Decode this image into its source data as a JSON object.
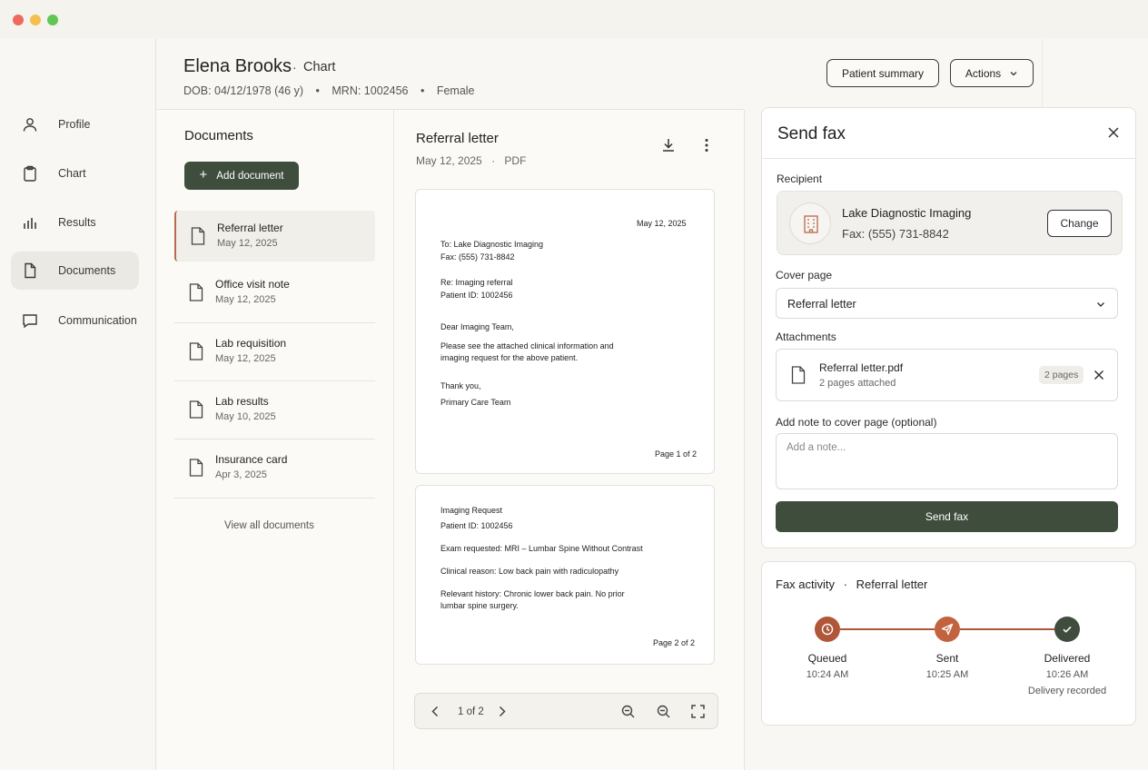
{
  "patient": {
    "name": "Elena Brooks",
    "sep": "·",
    "section": "Chart",
    "dob": "DOB: 04/12/1978 (46 y)",
    "dot": "•",
    "mrn": "MRN: 1002456",
    "sex": "Female"
  },
  "header_actions": {
    "summary_label": "Patient summary",
    "actions_label": "Actions"
  },
  "sidebar": {
    "items": [
      {
        "label": "Profile",
        "icon": "person-icon"
      },
      {
        "label": "Chart",
        "icon": "clipboard-icon"
      },
      {
        "label": "Results",
        "icon": "bar-chart-icon"
      },
      {
        "label": "Documents",
        "icon": "document-icon",
        "active": true
      },
      {
        "label": "Communication",
        "icon": "chat-bubble-icon"
      }
    ]
  },
  "documents": {
    "title": "Documents",
    "add_label": "Add document",
    "items": [
      {
        "name": "Referral letter",
        "date": "May 12, 2025",
        "active": true
      },
      {
        "name": "Office visit note",
        "date": "May 12, 2025"
      },
      {
        "name": "Lab requisition",
        "date": "May 12, 2025"
      },
      {
        "name": "Lab results",
        "date": "May 10, 2025"
      },
      {
        "name": "Insurance card",
        "date": "Apr 3, 2025"
      }
    ],
    "view_all": "View all documents"
  },
  "preview": {
    "title": "Referral letter",
    "date": "May 12, 2025",
    "sep": "·",
    "format": "PDF",
    "page1": {
      "date": "May 12, 2025",
      "to": "To:  Lake Diagnostic Imaging",
      "fax": "Fax:  (555) 731-8842",
      "re": "Re:  Imaging referral",
      "patient_id": "Patient ID:  1002456",
      "greeting": "Dear Imaging Team,",
      "body1": "Please see the attached clinical information and",
      "body2": "imaging request for the above patient.",
      "thanks": "Thank you,",
      "sign": "Primary Care Team",
      "footer": "Page 1 of 2"
    },
    "page2": {
      "title": "Imaging Request",
      "patient_id": "Patient ID:  1002456",
      "exam": "Exam requested:  MRI – Lumbar Spine Without Contrast",
      "reason": "Clinical reason:   Low back pain with radiculopathy",
      "history1": "Relevant history:  Chronic lower back pain. No prior",
      "history2": "lumbar spine surgery.",
      "footer": "Page 2 of 2"
    },
    "pager": {
      "text": "1 of 2"
    }
  },
  "fax": {
    "title": "Send fax",
    "recipient_label": "Recipient",
    "recipient_name": "Lake Diagnostic Imaging",
    "recipient_fax": "Fax: (555) 731-8842",
    "change_label": "Change",
    "cover_label": "Cover page",
    "cover_value": "Referral letter",
    "attachments_label": "Attachments",
    "attachment_name": "Referral letter.pdf",
    "attachment_sub": "2 pages attached",
    "attachment_pill": "2 pages",
    "note_label": "Add note to cover page (optional)",
    "note_placeholder": "Add a note...",
    "send_label": "Send fax"
  },
  "activity": {
    "title": "Fax activity",
    "sep": "·",
    "doc": "Referral letter",
    "steps": [
      {
        "label": "Queued",
        "time": "10:24 AM",
        "icon": "clock-icon"
      },
      {
        "label": "Sent",
        "time": "10:25 AM",
        "icon": "paper-plane-icon"
      },
      {
        "label": "Delivered",
        "time": "10:26 AM",
        "note": "Delivery recorded",
        "icon": "check-icon"
      }
    ],
    "colors": {
      "accent": "#b0573a",
      "done": "#3f4d3d"
    }
  },
  "colors": {
    "primary": "#3f4d3d",
    "accent": "#b86a4e",
    "background": "#f8f7f3"
  }
}
